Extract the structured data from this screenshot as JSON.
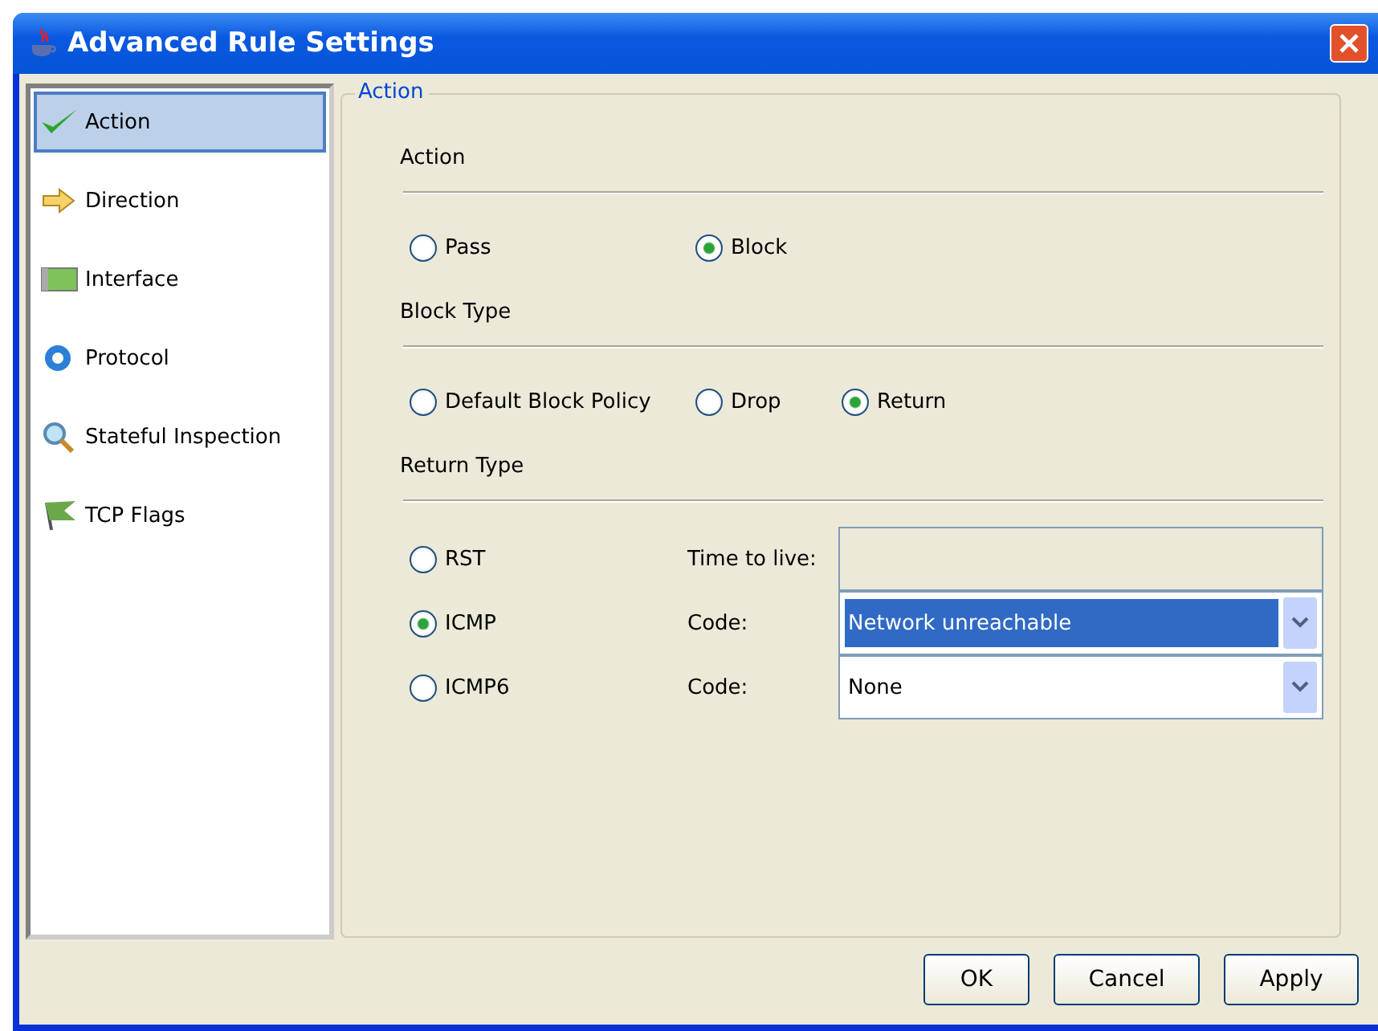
{
  "window": {
    "title": "Advanced Rule Settings"
  },
  "sidebar": {
    "items": [
      {
        "label": "Action",
        "selected": true
      },
      {
        "label": "Direction",
        "selected": false
      },
      {
        "label": "Interface",
        "selected": false
      },
      {
        "label": "Protocol",
        "selected": false
      },
      {
        "label": "Stateful Inspection",
        "selected": false
      },
      {
        "label": "TCP Flags",
        "selected": false
      }
    ]
  },
  "group": {
    "title": "Action",
    "sections": [
      {
        "heading": "Action",
        "options": [
          {
            "label": "Pass",
            "selected": false
          },
          {
            "label": "Block",
            "selected": true
          }
        ]
      },
      {
        "heading": "Block Type",
        "options": [
          {
            "label": "Default Block Policy",
            "selected": false
          },
          {
            "label": "Drop",
            "selected": false
          },
          {
            "label": "Return",
            "selected": true
          }
        ]
      }
    ],
    "return_type": {
      "heading": "Return Type",
      "rows": [
        {
          "label": "RST",
          "selected": false,
          "field_label": "Time to live:",
          "kind": "input"
        },
        {
          "label": "ICMP",
          "selected": true,
          "field_label": "Code:",
          "kind": "dropdown",
          "value": "Network unreachable",
          "highlighted": true
        },
        {
          "label": "ICMP6",
          "selected": false,
          "field_label": "Code:",
          "kind": "dropdown",
          "value": "None",
          "highlighted": false
        }
      ]
    }
  },
  "buttons": [
    "OK",
    "Cancel",
    "Apply"
  ]
}
